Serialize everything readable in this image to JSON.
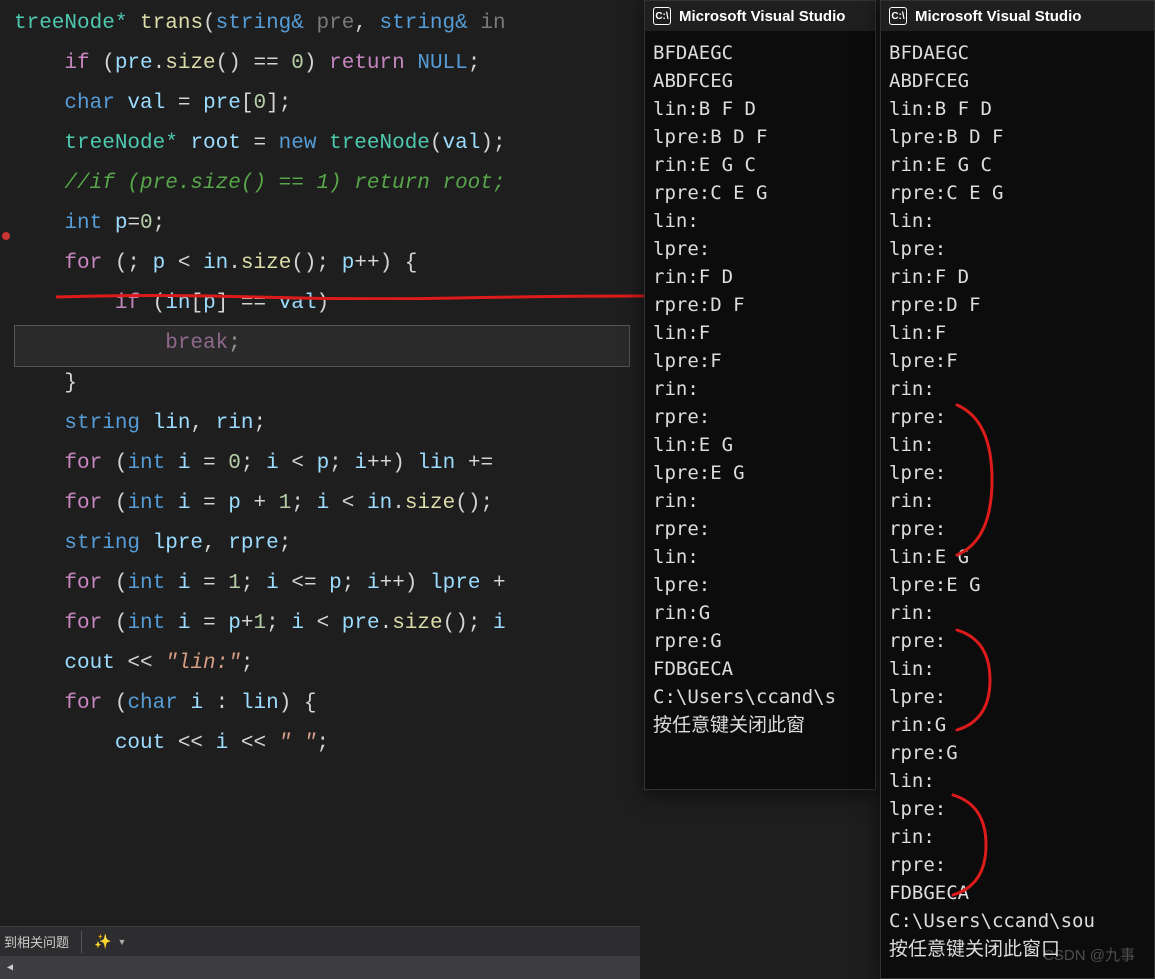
{
  "editor": {
    "line1": {
      "a": "treeNode* ",
      "b": "trans",
      "c": "(",
      "d": "string& ",
      "e": "pre",
      "f": ", ",
      "g": "string& ",
      "h": "in"
    },
    "line2": {
      "a": "    if ",
      "b": "(",
      "c": "pre",
      "d": ".",
      "e": "size",
      "f": "() == ",
      "g": "0",
      "h": ") ",
      "i": "return ",
      "j": "NULL",
      "k": ";"
    },
    "line3": "",
    "line4": {
      "a": "    char ",
      "b": "val ",
      "c": "= ",
      "d": "pre",
      "e": "[",
      "f": "0",
      "g": "];"
    },
    "line5": {
      "a": "    treeNode* ",
      "b": "root ",
      "c": "= ",
      "d": "new ",
      "e": "treeNode",
      "f": "(",
      "g": "val",
      "h": ");"
    },
    "line6": "    //if (pre.size() == 1) return root;",
    "line7": {
      "a": "    int ",
      "b": "p",
      "c": "=",
      "d": "0",
      "e": ";"
    },
    "line8": {
      "a": "    for ",
      "b": "(; ",
      "c": "p ",
      "d": "< ",
      "e": "in",
      "f": ".",
      "g": "size",
      "h": "(); ",
      "i": "p",
      "j": "++) {"
    },
    "line9": {
      "a": "        if ",
      "b": "(",
      "c": "in",
      "d": "[",
      "e": "p",
      "f": "] == ",
      "g": "val",
      "h": ")"
    },
    "line10": {
      "a": "            break",
      "b": ";"
    },
    "line11": "    }",
    "line12": "",
    "line13": {
      "a": "    string ",
      "b": "lin",
      "c": ", ",
      "d": "rin",
      "e": ";"
    },
    "line14": {
      "a": "    for ",
      "b": "(",
      "c": "int ",
      "d": "i ",
      "e": "= ",
      "f": "0",
      "g": "; ",
      "h": "i ",
      "i": "< ",
      "j": "p",
      "k": "; ",
      "l": "i",
      "m": "++) ",
      "n": "lin ",
      "o": "+="
    },
    "line15": {
      "a": "    for ",
      "b": "(",
      "c": "int ",
      "d": "i ",
      "e": "= ",
      "f": "p ",
      "g": "+ ",
      "h": "1",
      "i": "; ",
      "j": "i ",
      "k": "< ",
      "l": "in",
      "m": ".",
      "n": "size",
      "o": "();"
    },
    "line16": "",
    "line17": {
      "a": "    string ",
      "b": "lpre",
      "c": ", ",
      "d": "rpre",
      "e": ";"
    },
    "line18": {
      "a": "    for ",
      "b": "(",
      "c": "int ",
      "d": "i ",
      "e": "= ",
      "f": "1",
      "g": "; ",
      "h": "i ",
      "i": "<= ",
      "j": "p",
      "k": "; ",
      "l": "i",
      "m": "++) ",
      "n": "lpre ",
      "o": "+"
    },
    "line19": {
      "a": "    for ",
      "b": "(",
      "c": "int ",
      "d": "i ",
      "e": "= ",
      "f": "p",
      "g": "+",
      "h": "1",
      "i": "; ",
      "j": "i ",
      "k": "< ",
      "l": "pre",
      "m": ".",
      "n": "size",
      "o": "(); ",
      "p": "i"
    },
    "line20": "",
    "line21": {
      "a": "    cout ",
      "b": "<< ",
      "c": "\"lin:\"",
      "d": ";"
    },
    "line22": {
      "a": "    for ",
      "b": "(",
      "c": "char ",
      "d": "i ",
      "e": ": ",
      "f": "lin",
      "g": ") {"
    },
    "line23": {
      "a": "        cout ",
      "b": "<< ",
      "c": "i ",
      "d": "<< ",
      "e": "\" \"",
      "f": ";"
    }
  },
  "status": {
    "text": "到相关问题",
    "icon": "✨"
  },
  "terminal1": {
    "title": "Microsoft Visual Studio",
    "lines": [
      "BFDAEGC",
      "ABDFCEG",
      "lin:B F D",
      "lpre:B D F",
      "rin:E G C",
      "rpre:C E G",
      "lin:",
      "lpre:",
      "rin:F D",
      "rpre:D F",
      "lin:F",
      "lpre:F",
      "rin:",
      "rpre:",
      "lin:E G",
      "lpre:E G",
      "rin:",
      "rpre:",
      "lin:",
      "lpre:",
      "rin:G",
      "rpre:G",
      "FDBGECA",
      "C:\\Users\\ccand\\s",
      "按任意键关闭此窗"
    ]
  },
  "terminal2": {
    "title": "Microsoft Visual Studio",
    "lines": [
      "BFDAEGC",
      "ABDFCEG",
      "lin:B F D",
      "lpre:B D F",
      "rin:E G C",
      "rpre:C E G",
      "lin:",
      "lpre:",
      "rin:F D",
      "rpre:D F",
      "lin:F",
      "lpre:F",
      "rin:",
      "rpre:",
      "lin:",
      "lpre:",
      "rin:",
      "rpre:",
      "lin:E G",
      "lpre:E G",
      "rin:",
      "rpre:",
      "lin:",
      "lpre:",
      "rin:G",
      "rpre:G",
      "lin:",
      "lpre:",
      "rin:",
      "rpre:",
      "FDBGECA",
      "C:\\Users\\ccand\\sou",
      "按任意键关闭此窗口"
    ]
  },
  "watermark": "CSDN @九事"
}
